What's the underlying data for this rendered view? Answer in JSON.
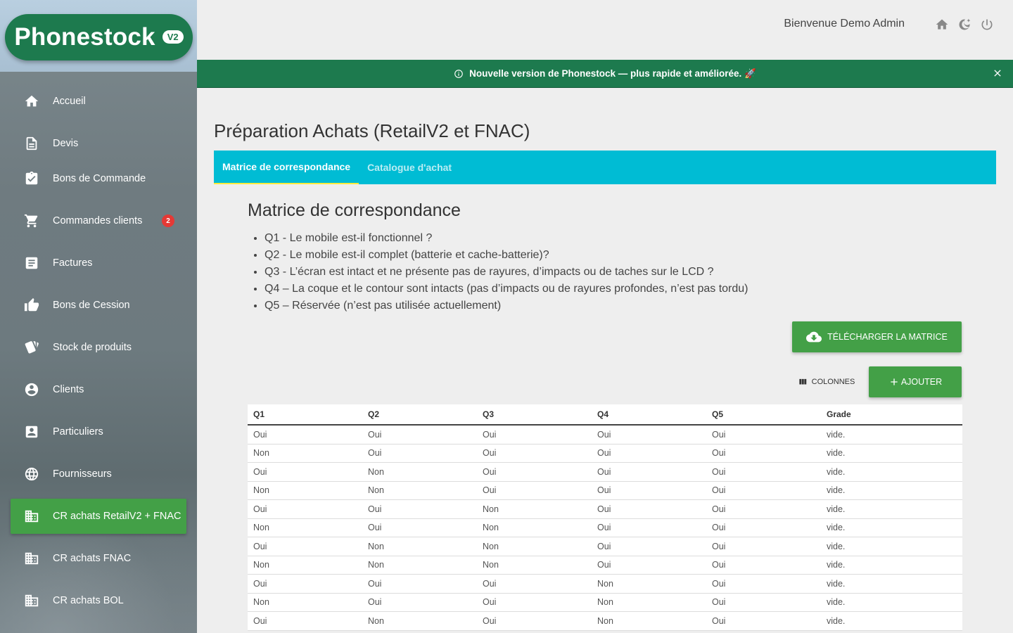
{
  "app": {
    "logo": "Phonestock",
    "logo_badge": "V2"
  },
  "sidebar": {
    "items": [
      {
        "label": "Accueil",
        "icon": "home-icon"
      },
      {
        "label": "Devis",
        "icon": "file-icon"
      },
      {
        "label": "Bons de Commande",
        "icon": "clipboard-check-icon"
      },
      {
        "label": "Commandes clients",
        "icon": "cart-icon",
        "badge": "2"
      },
      {
        "label": "Factures",
        "icon": "document-icon"
      },
      {
        "label": "Bons de Cession",
        "icon": "thumb-up-icon"
      },
      {
        "label": "Stock de produits",
        "icon": "cards-icon"
      },
      {
        "label": "Clients",
        "icon": "account-circle-icon"
      },
      {
        "label": "Particuliers",
        "icon": "account-box-icon"
      },
      {
        "label": "Fournisseurs",
        "icon": "globe-icon"
      },
      {
        "label": "CR achats RetailV2 + FNAC",
        "icon": "building-icon",
        "active": true
      },
      {
        "label": "CR achats FNAC",
        "icon": "building-icon"
      },
      {
        "label": "CR achats BOL",
        "icon": "building-icon"
      }
    ]
  },
  "header": {
    "welcome": "Bienvenue Demo Admin"
  },
  "banner": {
    "text": "Nouvelle version de Phonestock — plus rapide et améliorée. 🚀"
  },
  "page": {
    "title": "Préparation Achats (RetailV2 et FNAC)",
    "tabs": [
      {
        "label": "Matrice de correspondance",
        "active": true
      },
      {
        "label": "Catalogue d'achat",
        "active": false
      }
    ]
  },
  "matrix": {
    "title": "Matrice de correspondance",
    "questions": [
      "Q1 - Le mobile est-il fonctionnel ?",
      "Q2 - Le mobile est-il complet (batterie et cache-batterie)?",
      "Q3 - L’écran est intact et ne présente pas de rayures, d’impacts ou de taches sur le LCD ?",
      "Q4 – La coque et le contour sont intacts (pas d’impacts ou de rayures profondes, n’est pas tordu)",
      "Q5 – Réservée (n’est pas utilisée actuellement)"
    ],
    "download_label": "Télécharger la matrice",
    "columns_label": "Colonnes",
    "add_label": "Ajouter"
  },
  "table": {
    "headers": [
      "Q1",
      "Q2",
      "Q3",
      "Q4",
      "Q5",
      "Grade"
    ],
    "rows": [
      [
        "Oui",
        "Oui",
        "Oui",
        "Oui",
        "Oui",
        "vide."
      ],
      [
        "Non",
        "Oui",
        "Oui",
        "Oui",
        "Oui",
        "vide."
      ],
      [
        "Oui",
        "Non",
        "Oui",
        "Oui",
        "Oui",
        "vide."
      ],
      [
        "Non",
        "Non",
        "Oui",
        "Oui",
        "Oui",
        "vide."
      ],
      [
        "Oui",
        "Oui",
        "Non",
        "Oui",
        "Oui",
        "vide."
      ],
      [
        "Non",
        "Oui",
        "Non",
        "Oui",
        "Oui",
        "vide."
      ],
      [
        "Oui",
        "Non",
        "Non",
        "Oui",
        "Oui",
        "vide."
      ],
      [
        "Non",
        "Non",
        "Non",
        "Oui",
        "Oui",
        "vide."
      ],
      [
        "Oui",
        "Oui",
        "Oui",
        "Non",
        "Oui",
        "vide."
      ],
      [
        "Non",
        "Oui",
        "Oui",
        "Non",
        "Oui",
        "vide."
      ],
      [
        "Oui",
        "Non",
        "Oui",
        "Non",
        "Oui",
        "vide."
      ]
    ]
  },
  "colors": {
    "brand_green": "#1d7a4e",
    "accent_green": "#43a047",
    "tab_cyan": "#00bcd4",
    "tab_indicator": "#ffeb3b",
    "badge_red": "#e53935"
  }
}
